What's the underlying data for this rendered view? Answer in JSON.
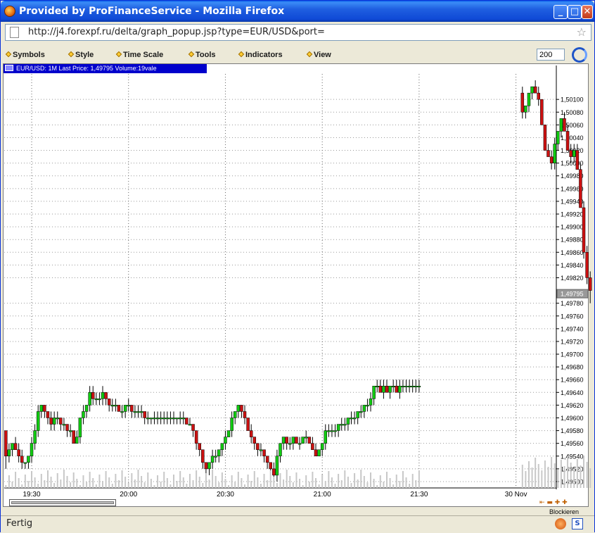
{
  "window": {
    "title": "Provided by ProFinanceService - Mozilla Firefox",
    "url": "http://j4.forexpf.ru/delta/graph_popup.jsp?type=EUR/USD&port=",
    "minimize": "_",
    "maximize": "□",
    "close": "✕",
    "status": "Fertig",
    "status_icon2": "S"
  },
  "menu": {
    "items": [
      "Symbols",
      "Style",
      "Time Scale",
      "Tools",
      "Indicators",
      "View"
    ],
    "count_value": "200",
    "blockieren": "Blockieren"
  },
  "info": {
    "text": "EUR/USD: 1M Last Price: 1,49795 Volume:19vale"
  },
  "colors": {
    "up": "#11cc11",
    "down": "#cc1111",
    "info_bg": "#0000cc",
    "volume": "#c8c8c8"
  },
  "chart_data": {
    "type": "candlestick",
    "symbol": "EUR/USD",
    "interval": "1M",
    "last_price": "1,49795",
    "last_price_value": 1.49795,
    "volume_text": "19vale",
    "ylim": [
      1.4949,
      1.5014
    ],
    "y_ticks": [
      1.501,
      1.5008,
      1.5006,
      1.5004,
      1.5002,
      1.5,
      1.4998,
      1.4996,
      1.4994,
      1.4992,
      1.499,
      1.4988,
      1.4986,
      1.4984,
      1.4982,
      1.4978,
      1.4976,
      1.4974,
      1.4972,
      1.497,
      1.4968,
      1.4966,
      1.4964,
      1.4962,
      1.496,
      1.4958,
      1.4956,
      1.4954,
      1.4952,
      1.495
    ],
    "y_tick_labels": [
      "1,50100",
      "1,50080",
      "1,50060",
      "1,50040",
      "1,50020",
      "1,50000",
      "1,49980",
      "1,49960",
      "1,49940",
      "1,49920",
      "1,49900",
      "1,49880",
      "1,49860",
      "1,49840",
      "1,49820",
      "1,49780",
      "1,49760",
      "1,49740",
      "1,49720",
      "1,49700",
      "1,49680",
      "1,49660",
      "1,49640",
      "1,49620",
      "1,49600",
      "1,49580",
      "1,49560",
      "1,49540",
      "1,49520",
      "1,49500"
    ],
    "x_ticks": [
      {
        "index": 8,
        "label": "19:30"
      },
      {
        "index": 38,
        "label": "20:00"
      },
      {
        "index": 68,
        "label": "20:30"
      },
      {
        "index": 98,
        "label": "21:00"
      },
      {
        "index": 128,
        "label": "21:30"
      },
      {
        "index": 158,
        "label": "30 Nov"
      }
    ],
    "grid": true,
    "candles": [
      [
        1.4958,
        1.4958,
        1.4952,
        1.4954
      ],
      [
        1.4954,
        1.4956,
        1.4953,
        1.4955
      ],
      [
        1.4955,
        1.4956,
        1.4954,
        1.4956
      ],
      [
        1.4956,
        1.4957,
        1.4955,
        1.4955
      ],
      [
        1.4955,
        1.4956,
        1.4953,
        1.4954
      ],
      [
        1.4954,
        1.4955,
        1.4952,
        1.4953
      ],
      [
        1.4953,
        1.4953,
        1.4952,
        1.4953
      ],
      [
        1.4953,
        1.4954,
        1.4952,
        1.4954
      ],
      [
        1.4954,
        1.4957,
        1.4953,
        1.4956
      ],
      [
        1.4956,
        1.4959,
        1.4955,
        1.4958
      ],
      [
        1.4958,
        1.4962,
        1.4957,
        1.4961
      ],
      [
        1.4961,
        1.4962,
        1.496,
        1.4962
      ],
      [
        1.4962,
        1.4962,
        1.496,
        1.4961
      ],
      [
        1.4961,
        1.4961,
        1.4959,
        1.496
      ],
      [
        1.496,
        1.4961,
        1.4958,
        1.4959
      ],
      [
        1.4959,
        1.4961,
        1.4958,
        1.496
      ],
      [
        1.496,
        1.4961,
        1.4959,
        1.496
      ],
      [
        1.496,
        1.496,
        1.4958,
        1.4959
      ],
      [
        1.4959,
        1.496,
        1.4958,
        1.4959
      ],
      [
        1.4959,
        1.4959,
        1.4957,
        1.4958
      ],
      [
        1.4958,
        1.4959,
        1.4957,
        1.4958
      ],
      [
        1.4958,
        1.4958,
        1.4956,
        1.4956
      ],
      [
        1.4956,
        1.4958,
        1.4956,
        1.4957
      ],
      [
        1.4957,
        1.496,
        1.4956,
        1.496
      ],
      [
        1.496,
        1.4962,
        1.4959,
        1.4961
      ],
      [
        1.4961,
        1.4962,
        1.496,
        1.4962
      ],
      [
        1.4962,
        1.4965,
        1.4961,
        1.4964
      ],
      [
        1.4964,
        1.4965,
        1.4962,
        1.4963
      ],
      [
        1.4963,
        1.4964,
        1.4962,
        1.4963
      ],
      [
        1.4963,
        1.4964,
        1.4962,
        1.4963
      ],
      [
        1.4963,
        1.4965,
        1.4962,
        1.4964
      ],
      [
        1.4964,
        1.4964,
        1.4962,
        1.4963
      ],
      [
        1.4963,
        1.4963,
        1.4961,
        1.4962
      ],
      [
        1.4962,
        1.4963,
        1.4961,
        1.4962
      ],
      [
        1.4962,
        1.4963,
        1.4961,
        1.4962
      ],
      [
        1.4962,
        1.4962,
        1.4961,
        1.4961
      ],
      [
        1.4961,
        1.4962,
        1.496,
        1.4961
      ],
      [
        1.4961,
        1.4962,
        1.496,
        1.4962
      ],
      [
        1.4962,
        1.4963,
        1.4961,
        1.4962
      ],
      [
        1.4962,
        1.4962,
        1.496,
        1.4961
      ],
      [
        1.4961,
        1.4962,
        1.496,
        1.4961
      ],
      [
        1.4961,
        1.4962,
        1.496,
        1.4961
      ],
      [
        1.4961,
        1.4962,
        1.496,
        1.4961
      ],
      [
        1.4961,
        1.4961,
        1.4959,
        1.496
      ],
      [
        1.496,
        1.4961,
        1.4959,
        1.496
      ],
      [
        1.496,
        1.496,
        1.4959,
        1.496
      ],
      [
        1.496,
        1.4961,
        1.4959,
        1.496
      ],
      [
        1.496,
        1.4961,
        1.4959,
        1.496
      ],
      [
        1.496,
        1.4961,
        1.4959,
        1.496
      ],
      [
        1.496,
        1.4961,
        1.4959,
        1.496
      ],
      [
        1.496,
        1.4961,
        1.4959,
        1.496
      ],
      [
        1.496,
        1.4961,
        1.4959,
        1.496
      ],
      [
        1.496,
        1.4961,
        1.4959,
        1.496
      ],
      [
        1.496,
        1.496,
        1.4959,
        1.496
      ],
      [
        1.496,
        1.4961,
        1.4959,
        1.496
      ],
      [
        1.496,
        1.4961,
        1.4959,
        1.496
      ],
      [
        1.496,
        1.496,
        1.4959,
        1.4959
      ],
      [
        1.4959,
        1.496,
        1.4959,
        1.4959
      ],
      [
        1.4959,
        1.4959,
        1.4957,
        1.4958
      ],
      [
        1.4958,
        1.4958,
        1.4955,
        1.4956
      ],
      [
        1.4956,
        1.4956,
        1.4954,
        1.4955
      ],
      [
        1.4955,
        1.4955,
        1.4952,
        1.4953
      ],
      [
        1.4953,
        1.4953,
        1.4951,
        1.4952
      ],
      [
        1.4952,
        1.4953,
        1.4951,
        1.4953
      ],
      [
        1.4953,
        1.4955,
        1.4952,
        1.4954
      ],
      [
        1.4954,
        1.4955,
        1.4953,
        1.4954
      ],
      [
        1.4954,
        1.4955,
        1.4953,
        1.4955
      ],
      [
        1.4955,
        1.4956,
        1.4954,
        1.4956
      ],
      [
        1.4956,
        1.4958,
        1.4955,
        1.4957
      ],
      [
        1.4957,
        1.4958,
        1.4957,
        1.4958
      ],
      [
        1.4958,
        1.4961,
        1.4957,
        1.496
      ],
      [
        1.496,
        1.4961,
        1.4959,
        1.4961
      ],
      [
        1.4961,
        1.4962,
        1.496,
        1.4962
      ],
      [
        1.4962,
        1.4962,
        1.496,
        1.4961
      ],
      [
        1.4961,
        1.4962,
        1.4959,
        1.496
      ],
      [
        1.496,
        1.496,
        1.4958,
        1.4958
      ],
      [
        1.4958,
        1.4959,
        1.4956,
        1.4957
      ],
      [
        1.4957,
        1.4957,
        1.4955,
        1.4956
      ],
      [
        1.4956,
        1.4956,
        1.4954,
        1.4955
      ],
      [
        1.4955,
        1.4956,
        1.4954,
        1.4955
      ],
      [
        1.4955,
        1.4955,
        1.4953,
        1.4954
      ],
      [
        1.4954,
        1.4954,
        1.4952,
        1.4953
      ],
      [
        1.4953,
        1.4953,
        1.4951,
        1.4952
      ],
      [
        1.4952,
        1.4953,
        1.495,
        1.4951
      ],
      [
        1.4951,
        1.4955,
        1.495,
        1.4954
      ],
      [
        1.4954,
        1.4956,
        1.4953,
        1.4956
      ],
      [
        1.4956,
        1.4957,
        1.4955,
        1.4957
      ],
      [
        1.4957,
        1.4957,
        1.4955,
        1.4956
      ],
      [
        1.4956,
        1.4957,
        1.4955,
        1.4956
      ],
      [
        1.4956,
        1.4957,
        1.4955,
        1.4957
      ],
      [
        1.4957,
        1.4957,
        1.4956,
        1.4956
      ],
      [
        1.4956,
        1.4957,
        1.4955,
        1.4956
      ],
      [
        1.4956,
        1.4957,
        1.4956,
        1.4957
      ],
      [
        1.4957,
        1.4958,
        1.4956,
        1.4957
      ],
      [
        1.4957,
        1.4957,
        1.4956,
        1.4956
      ],
      [
        1.4956,
        1.4957,
        1.4955,
        1.4955
      ],
      [
        1.4955,
        1.4956,
        1.4954,
        1.4954
      ],
      [
        1.4954,
        1.4955,
        1.4954,
        1.4955
      ],
      [
        1.4955,
        1.4956,
        1.4954,
        1.4956
      ],
      [
        1.4956,
        1.4959,
        1.4955,
        1.4958
      ],
      [
        1.4958,
        1.4959,
        1.4957,
        1.4958
      ],
      [
        1.4958,
        1.4959,
        1.4957,
        1.4958
      ],
      [
        1.4958,
        1.4959,
        1.4957,
        1.4958
      ],
      [
        1.4958,
        1.4959,
        1.4957,
        1.4959
      ],
      [
        1.4959,
        1.496,
        1.4958,
        1.4959
      ],
      [
        1.4959,
        1.496,
        1.4958,
        1.4959
      ],
      [
        1.4959,
        1.496,
        1.4958,
        1.496
      ],
      [
        1.496,
        1.4961,
        1.4959,
        1.496
      ],
      [
        1.496,
        1.4961,
        1.4959,
        1.496
      ],
      [
        1.496,
        1.4961,
        1.4959,
        1.4961
      ],
      [
        1.4961,
        1.4962,
        1.496,
        1.4961
      ],
      [
        1.4961,
        1.4962,
        1.496,
        1.4962
      ],
      [
        1.4962,
        1.4963,
        1.4961,
        1.4962
      ],
      [
        1.4962,
        1.4964,
        1.4961,
        1.4963
      ],
      [
        1.4963,
        1.4965,
        1.4962,
        1.4965
      ],
      [
        1.4965,
        1.4966,
        1.4964,
        1.4965
      ],
      [
        1.4965,
        1.4966,
        1.4964,
        1.4964
      ],
      [
        1.4964,
        1.4966,
        1.4963,
        1.4965
      ],
      [
        1.4965,
        1.4966,
        1.4964,
        1.4964
      ],
      [
        1.4964,
        1.4965,
        1.4963,
        1.4965
      ],
      [
        1.4965,
        1.4966,
        1.4964,
        1.4965
      ],
      [
        1.4965,
        1.4966,
        1.4964,
        1.4964
      ],
      [
        1.4964,
        1.4966,
        1.4963,
        1.4965
      ],
      [
        1.4965,
        1.4966,
        1.4964,
        1.4965
      ],
      [
        1.4965,
        1.4966,
        1.4964,
        1.4965
      ],
      [
        1.4965,
        1.4966,
        1.4964,
        1.4965
      ],
      [
        1.4965,
        1.4966,
        1.4964,
        1.4965
      ],
      [
        1.4965,
        1.4966,
        1.4964,
        1.4965
      ],
      [
        1.4965,
        1.4966,
        1.4964,
        1.4965
      ],
      [
        1.4965,
        1.4966,
        1.4964,
        1.4965
      ],
      [
        1.4965,
        1.4966,
        1.4964,
        1.4965
      ],
      [
        1.4965,
        1.4966,
        1.4964,
        1.4965
      ],
      [
        1.4965,
        1.4966,
        1.4964,
        1.4965
      ],
      [
        1.4965,
        1.4966,
        1.4964,
        1.4965
      ],
      [
        1.4965,
        1.4966,
        1.4964,
        1.4965
      ],
      [
        1.4965,
        1.4966,
        1.4964,
        1.4965
      ],
      [
        1.4965,
        1.4966,
        1.4964,
        1.4965
      ],
      [
        1.4965,
        1.4966,
        1.4964,
        1.4965
      ],
      [
        1.4965,
        1.4966,
        1.4964,
        1.4965
      ],
      [
        1.4965,
        1.4966,
        1.4964,
        1.4965
      ],
      [
        1.4965,
        1.4966,
        1.4964,
        1.4965
      ],
      [
        1.4965,
        1.4966,
        1.4964,
        1.4965
      ],
      [
        1.4965,
        1.4966,
        1.4964,
        1.4965
      ],
      [
        1.4965,
        1.4966,
        1.4964,
        1.4965
      ],
      [
        1.4965,
        1.4966,
        1.4964,
        1.4965
      ],
      [
        1.4965,
        1.4966,
        1.4964,
        1.4965
      ],
      [
        1.4965,
        1.4966,
        1.4964,
        1.4965
      ],
      [
        1.4965,
        1.4966,
        1.4964,
        1.4965
      ],
      [
        1.4965,
        1.4966,
        1.4964,
        1.4965
      ],
      [
        1.4965,
        1.4966,
        1.4964,
        1.4965
      ],
      [
        1.4965,
        1.4966,
        1.4964,
        1.4965
      ],
      [
        1.4965,
        1.4966,
        1.4964,
        1.4965
      ],
      [
        1.4965,
        1.4966,
        1.4964,
        1.4965
      ],
      [
        1.4965,
        1.4966,
        1.4964,
        1.4965
      ],
      [
        1.4965,
        1.4966,
        1.4964,
        1.4965
      ],
      [
        1.4965,
        1.4966,
        1.4964,
        1.4965
      ],
      [
        1.4965,
        1.4966,
        1.4964,
        1.4965
      ],
      [
        1.4965,
        1.4966,
        1.4964,
        1.4965
      ],
      [
        1.4965,
        1.4966,
        1.4964,
        1.4965
      ],
      [
        1.4965,
        1.4966,
        1.4964,
        1.4965
      ],
      [
        1.5011,
        1.5012,
        1.5007,
        1.5008
      ],
      [
        1.5008,
        1.5009,
        1.5007,
        1.5009
      ],
      [
        1.5009,
        1.5011,
        1.5008,
        1.5011
      ],
      [
        1.5011,
        1.5012,
        1.501,
        1.5012
      ],
      [
        1.5012,
        1.5013,
        1.5011,
        1.5011
      ],
      [
        1.5011,
        1.5012,
        1.5009,
        1.501
      ],
      [
        1.501,
        1.501,
        1.5006,
        1.5006
      ],
      [
        1.5006,
        1.5006,
        1.5002,
        1.5002
      ],
      [
        1.5002,
        1.5003,
        1.5001,
        1.5001
      ],
      [
        1.5001,
        1.5002,
        1.4999,
        1.5
      ],
      [
        1.5,
        1.5004,
        1.4999,
        1.5003
      ],
      [
        1.5003,
        1.5005,
        1.5002,
        1.5005
      ],
      [
        1.5005,
        1.5007,
        1.5004,
        1.5007
      ],
      [
        1.5007,
        1.5008,
        1.5005,
        1.5005
      ],
      [
        1.5005,
        1.5006,
        1.5002,
        1.5002
      ],
      [
        1.5002,
        1.5003,
        1.5,
        1.5001
      ],
      [
        1.5001,
        1.5003,
        1.5,
        1.5002
      ],
      [
        1.5002,
        1.5003,
        1.4999,
        1.4999
      ],
      [
        1.4999,
        1.5,
        1.4993,
        1.4993
      ],
      [
        1.4993,
        1.4994,
        1.4985,
        1.4986
      ],
      [
        1.4986,
        1.4987,
        1.4981,
        1.4982
      ],
      [
        1.4982,
        1.4983,
        1.4978,
        1.498
      ]
    ],
    "volumes": []
  }
}
